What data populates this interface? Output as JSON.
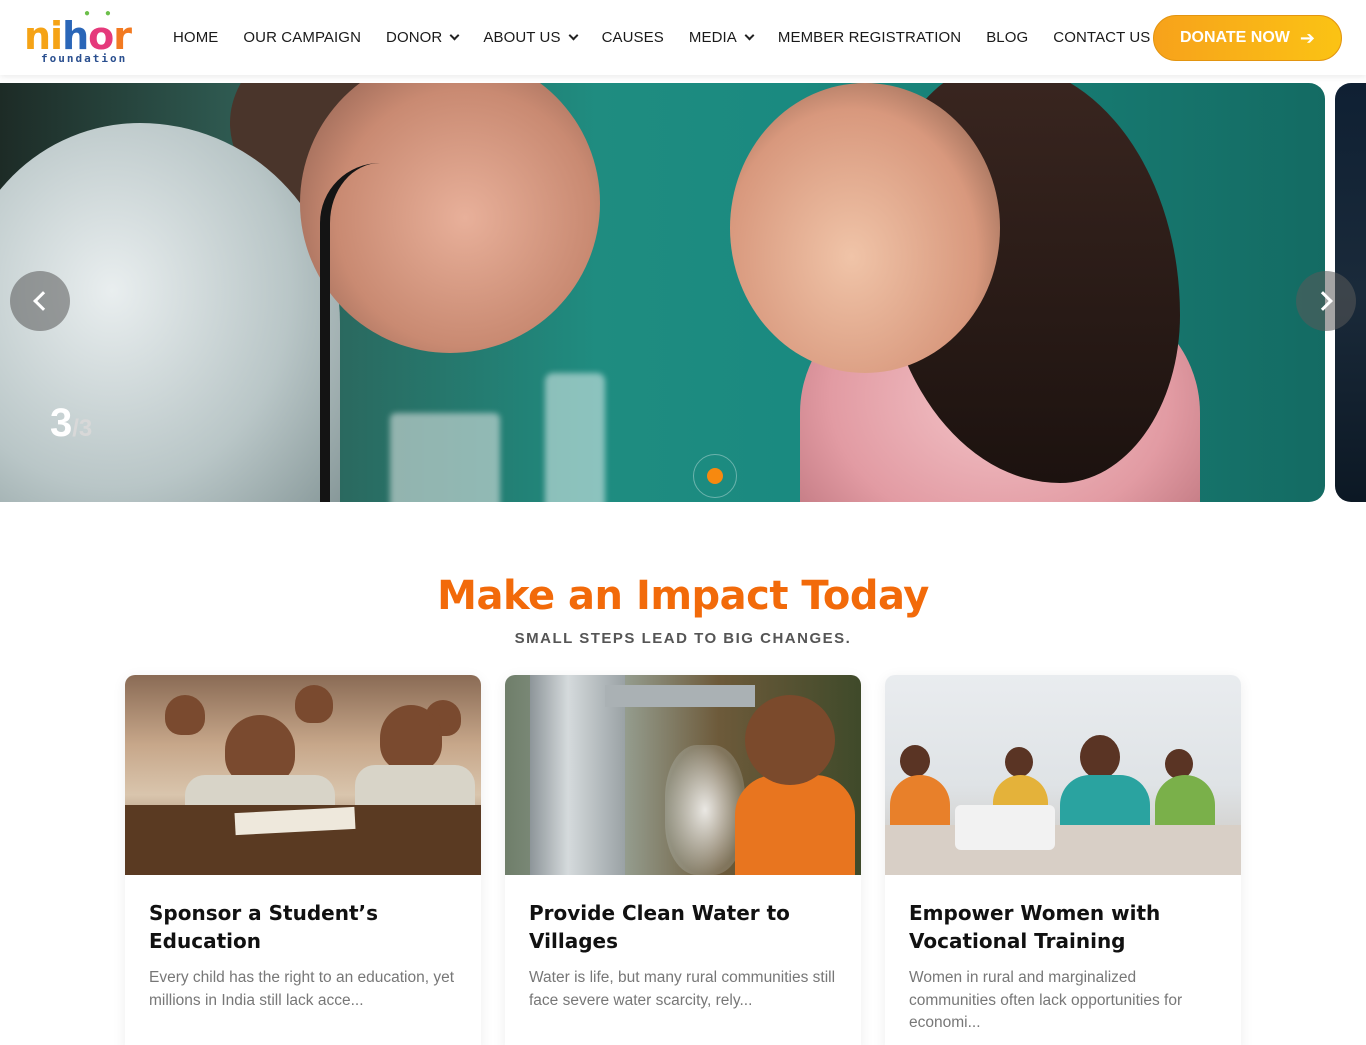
{
  "brand": {
    "logo_text": [
      "ni",
      "h",
      "o",
      "r"
    ],
    "logo_subtitle": "foundation",
    "colors": {
      "accent_orange": "#f26a0a",
      "donate_gradient_start": "#f7a21b",
      "donate_gradient_end": "#fbc314"
    }
  },
  "nav": {
    "items": [
      {
        "label": "HOME",
        "has_dropdown": false
      },
      {
        "label": "OUR CAMPAIGN",
        "has_dropdown": false
      },
      {
        "label": "DONOR",
        "has_dropdown": true
      },
      {
        "label": "ABOUT US",
        "has_dropdown": true
      },
      {
        "label": "CAUSES",
        "has_dropdown": false
      },
      {
        "label": "MEDIA",
        "has_dropdown": true
      },
      {
        "label": "MEMBER REGISTRATION",
        "has_dropdown": false
      },
      {
        "label": "BLOG",
        "has_dropdown": false
      },
      {
        "label": "CONTACT US",
        "has_dropdown": false
      }
    ],
    "donate_label": "DONATE NOW",
    "donate_icon": "arrow-right-icon"
  },
  "hero": {
    "current_slide": "3",
    "total_slides": "/3",
    "prev_icon": "chevron-left-icon",
    "next_icon": "chevron-right-icon"
  },
  "impact": {
    "title": "Make an Impact Today",
    "subtitle": "SMALL STEPS LEAD TO BIG CHANGES.",
    "cards": [
      {
        "title": "Sponsor a Student’s Education",
        "text": "Every child has the right to an education, yet millions in India still lack acce..."
      },
      {
        "title": "Provide Clean Water to Villages",
        "text": "Water is life, but many rural communities still face severe water scarcity, rely..."
      },
      {
        "title": "Empower Women with Vocational Training",
        "text": "Women in rural and marginalized communities often lack opportunities for economi..."
      }
    ]
  }
}
